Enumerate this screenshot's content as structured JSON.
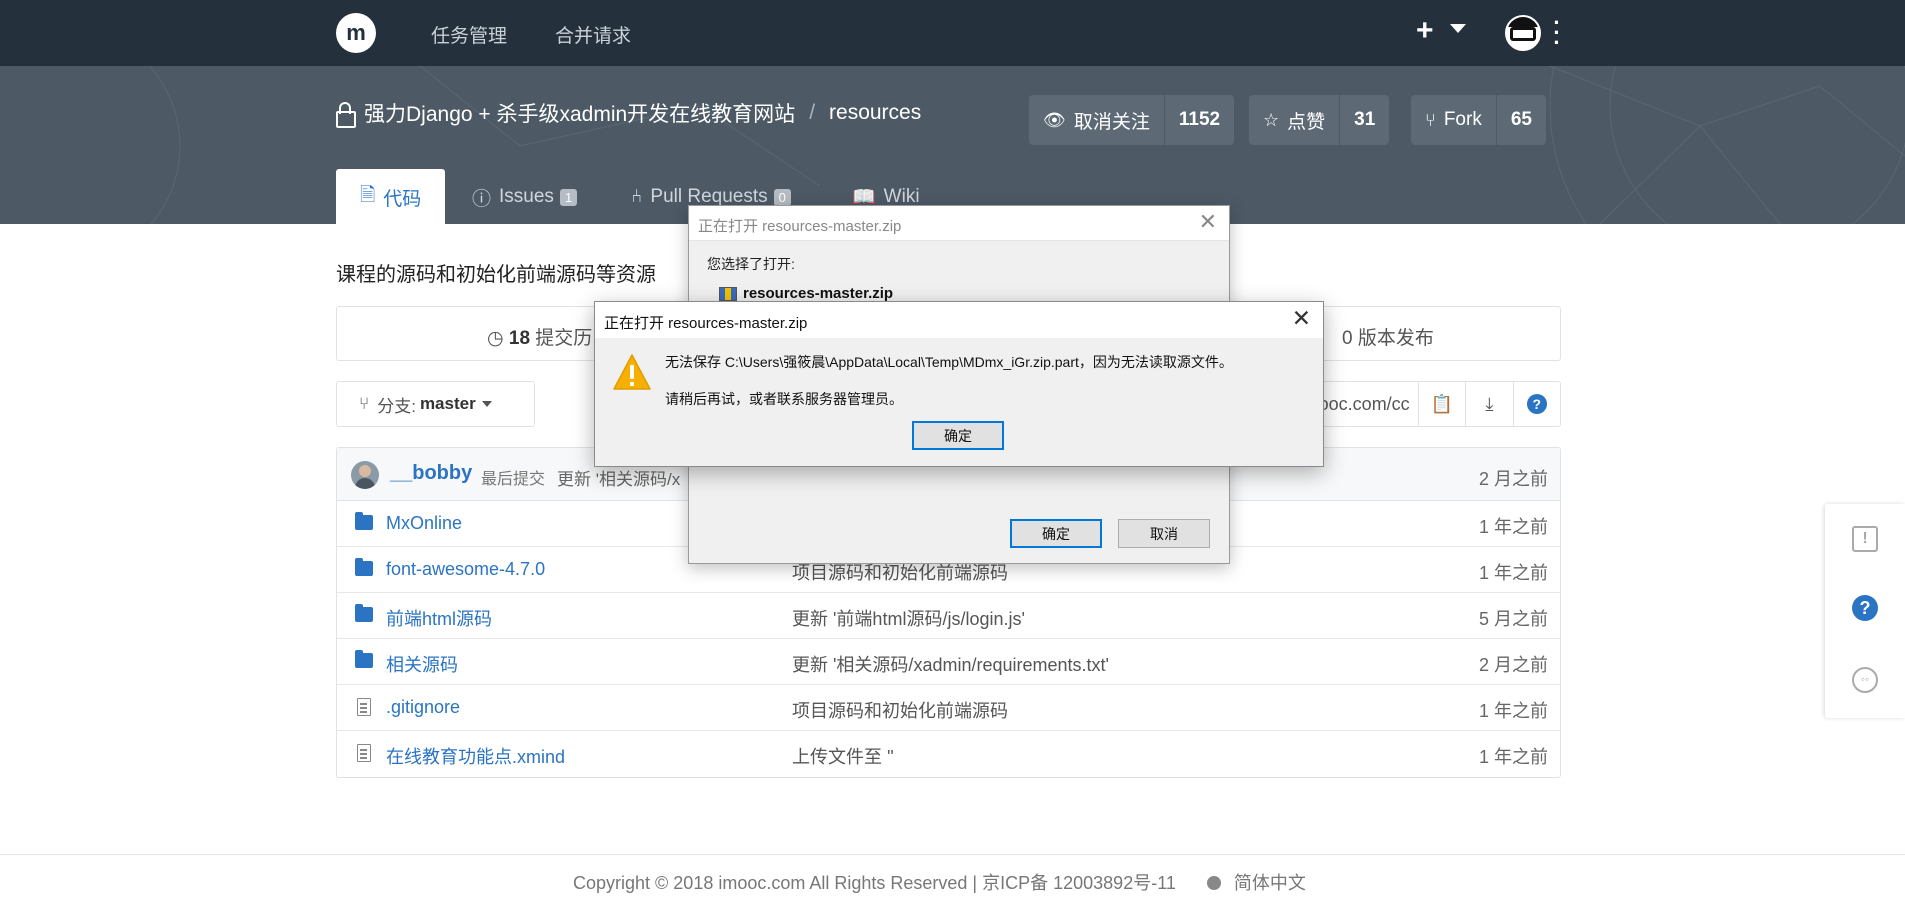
{
  "topnav": {
    "logo": "m",
    "links": [
      "任务管理",
      "合并请求"
    ],
    "plus": "+"
  },
  "repo": {
    "owner": "强力Django + 杀手级xadmin开发在线教育网站",
    "separator": "/",
    "name": "resources",
    "watch": {
      "label": "取消关注",
      "count": "1152",
      "icon": "eye-icon"
    },
    "star": {
      "label": "点赞",
      "count": "31",
      "icon": "star-icon"
    },
    "fork": {
      "label": "Fork",
      "count": "65",
      "icon": "fork-icon"
    }
  },
  "tabs": [
    {
      "label": "代码",
      "icon": "code-file-icon",
      "active": true
    },
    {
      "label": "Issues",
      "badge": "1",
      "icon": "issue-icon"
    },
    {
      "label": "Pull Requests",
      "badge": "0",
      "icon": "pull-request-icon"
    },
    {
      "label": "Wiki",
      "icon": "book-icon"
    }
  ],
  "description": "课程的源码和初始化前端源码等资源",
  "stats": {
    "commits_count": "18",
    "commits_label": "提交历",
    "releases_label": "0 版本发布"
  },
  "branch": {
    "prefix": "分支:",
    "name": "master"
  },
  "clone_url": "ooc.com/cc",
  "last_commit": {
    "author": "__bobby",
    "label": "最后提交",
    "message": "更新 '相关源码/x",
    "time": "2 月之前"
  },
  "files": [
    {
      "name": "MxOnline",
      "type": "folder",
      "message": "",
      "time": "1 年之前"
    },
    {
      "name": "font-awesome-4.7.0",
      "type": "folder",
      "message": "项目源码和初始化前端源码",
      "time": "1 年之前"
    },
    {
      "name": "前端html源码",
      "type": "folder",
      "message": "更新 '前端html源码/js/login.js'",
      "time": "5 月之前"
    },
    {
      "name": "相关源码",
      "type": "folder",
      "message": "更新 '相关源码/xadmin/requirements.txt'",
      "time": "2 月之前"
    },
    {
      "name": ".gitignore",
      "type": "file",
      "message": "项目源码和初始化前端源码",
      "time": "1 年之前"
    },
    {
      "name": "在线教育功能点.xmind",
      "type": "file",
      "message": "上传文件至 ''",
      "time": "1 年之前"
    }
  ],
  "footer": {
    "copyright": "Copyright © 2018 imooc.com All Rights Reserved | 京ICP备 12003892号-11",
    "language": "简体中文"
  },
  "side_panel": {
    "feedback": "!",
    "help": "?",
    "chat": "◦◦"
  },
  "dialog_back": {
    "title": "正在打开 resources-master.zip",
    "chosen_label": "您选择了打开:",
    "filename": "resources-master.zip",
    "ok": "确定",
    "cancel": "取消"
  },
  "dialog_front": {
    "title": "正在打开 resources-master.zip",
    "message": "无法保存 C:\\Users\\强筱晨\\AppData\\Local\\Temp\\MDmx_iGr.zip.part，因为无法读取源文件。",
    "hint": "请稍后再试，或者联系服务器管理员。",
    "ok": "确定"
  },
  "colors": {
    "nav_bg": "#24313c",
    "header_bg": "#4d5a66",
    "link": "#2b74c3",
    "warning": "#f5b000"
  }
}
